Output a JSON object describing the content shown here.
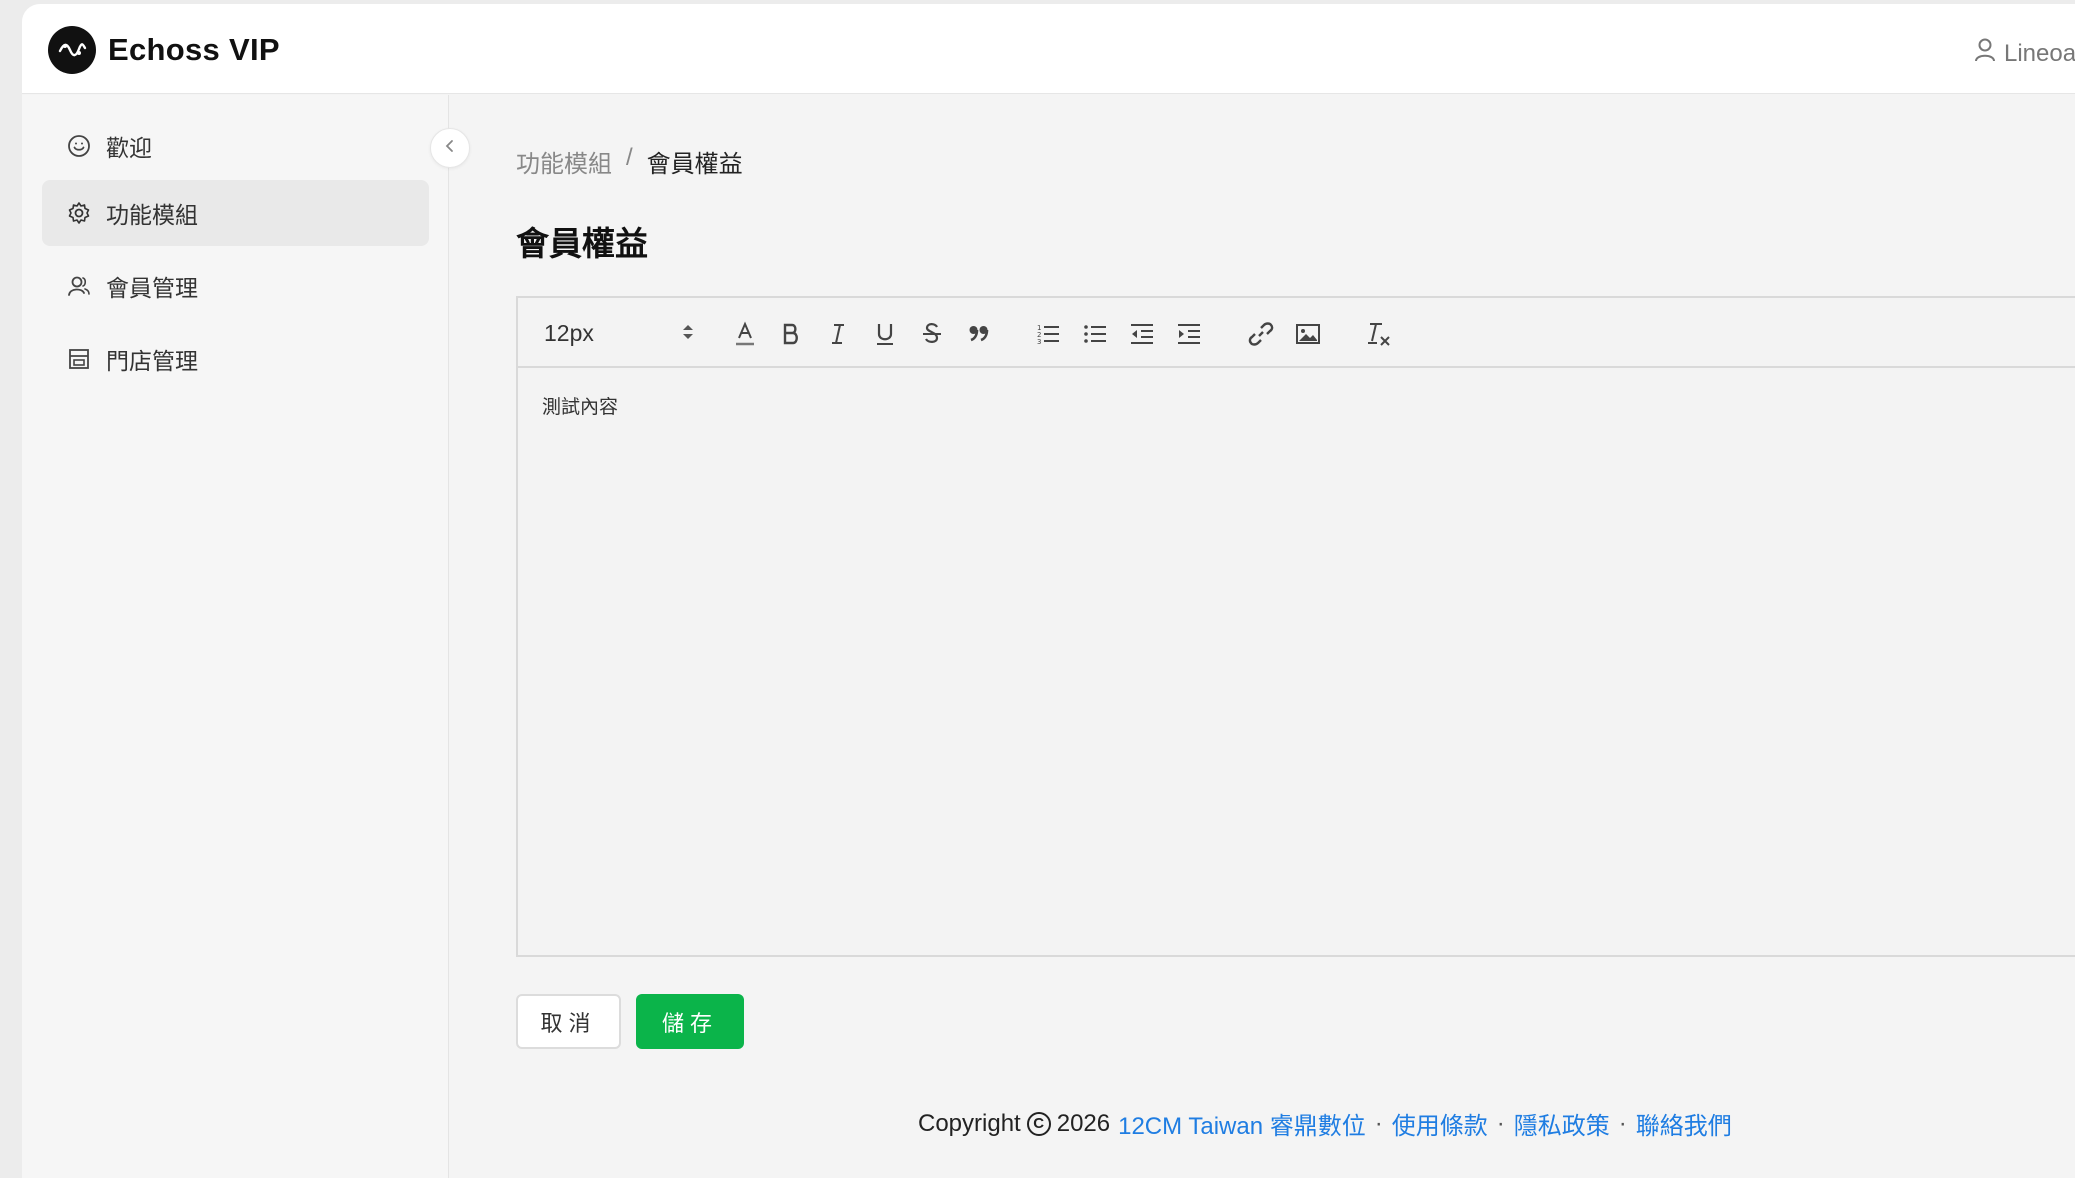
{
  "app": {
    "title": "Echoss VIP",
    "user_name": "Lineoa"
  },
  "sidebar": {
    "items": [
      {
        "label": "歡迎",
        "icon": "smile-icon"
      },
      {
        "label": "功能模組",
        "icon": "gear-icon",
        "active": true
      },
      {
        "label": "會員管理",
        "icon": "users-icon"
      },
      {
        "label": "門店管理",
        "icon": "store-icon"
      }
    ]
  },
  "breadcrumb": {
    "parent": "功能模組",
    "separator": "/",
    "current": "會員權益"
  },
  "page_title": "會員權益",
  "editor": {
    "font_size": "12px",
    "toolbar": [
      "font-color",
      "bold",
      "italic",
      "underline",
      "strikethrough",
      "blockquote",
      "ordered-list",
      "bullet-list",
      "outdent",
      "indent",
      "link",
      "image",
      "clear-format"
    ],
    "content": "測試內容"
  },
  "buttons": {
    "cancel": "取消",
    "save": "儲存"
  },
  "footer": {
    "copyright_prefix": "Copyright",
    "copyright_symbol": "C",
    "year": "2026",
    "company": "12CM Taiwan 睿鼎數位",
    "dot": "·",
    "terms": "使用條款",
    "privacy": "隱私政策",
    "contact": "聯絡我們"
  },
  "colors": {
    "accent": "#0bb44a",
    "link": "#1f7de2",
    "logo_bg": "#111111"
  }
}
